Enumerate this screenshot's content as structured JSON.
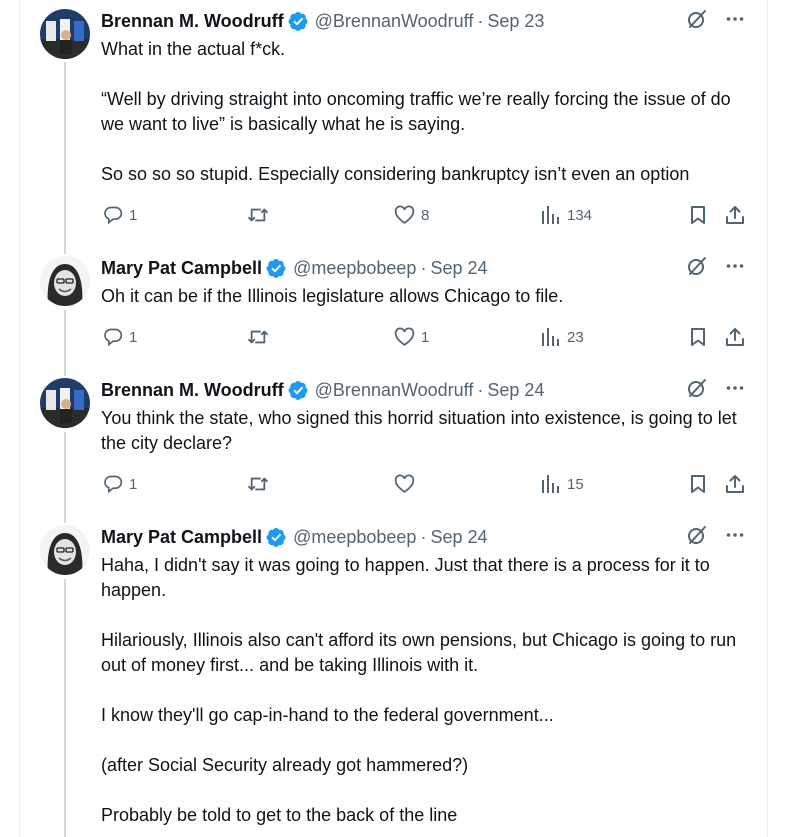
{
  "colors": {
    "text_primary": "#0f1419",
    "text_secondary": "#536471",
    "verified_blue": "#1d9bf0",
    "thread_line": "#cfd9de",
    "border": "#eff3f4"
  },
  "icons": {
    "verified": "verified-badge-icon",
    "grok": "grok-icon",
    "more": "more-options-icon",
    "reply": "reply-icon",
    "retweet": "retweet-icon",
    "like": "heart-icon",
    "views": "views-chart-icon",
    "bookmark": "bookmark-icon",
    "share": "share-icon"
  },
  "tweets": [
    {
      "author": "Brennan M. Woodruff",
      "handle": "@BrennanWoodruff",
      "dot": "·",
      "date": "Sep 23",
      "paragraphs": [
        "What in the actual f*ck.",
        "“Well by driving straight into oncoming traffic we’re really forcing the issue of do we want to live” is basically what he is saying.",
        "So so so so stupid. Especially considering bankruptcy isn’t even an option"
      ],
      "replies": "1",
      "retweets": "",
      "likes": "8",
      "views": "134"
    },
    {
      "author": "Mary Pat Campbell",
      "handle": "@meepbobeep",
      "dot": "·",
      "date": "Sep 24",
      "paragraphs": [
        "Oh it can be if the Illinois legislature allows Chicago to file."
      ],
      "replies": "1",
      "retweets": "",
      "likes": "1",
      "views": "23"
    },
    {
      "author": "Brennan M. Woodruff",
      "handle": "@BrennanWoodruff",
      "dot": "·",
      "date": "Sep 24",
      "paragraphs": [
        "You think the state, who signed this horrid situation into existence, is going to let the city declare?"
      ],
      "replies": "1",
      "retweets": "",
      "likes": "",
      "views": "15"
    },
    {
      "author": "Mary Pat Campbell",
      "handle": "@meepbobeep",
      "dot": "·",
      "date": "Sep 24",
      "paragraphs": [
        "Haha, I didn't say it was going to happen. Just that there is a process for it to happen.",
        "Hilariously, Illinois also can't afford its own pensions, but Chicago is going to run out of money first... and be taking Illinois with it.",
        "I know they'll go cap-in-hand to the federal government...",
        "(after Social Security already got hammered?)",
        "Probably be told to get to the back of the line"
      ]
    }
  ]
}
